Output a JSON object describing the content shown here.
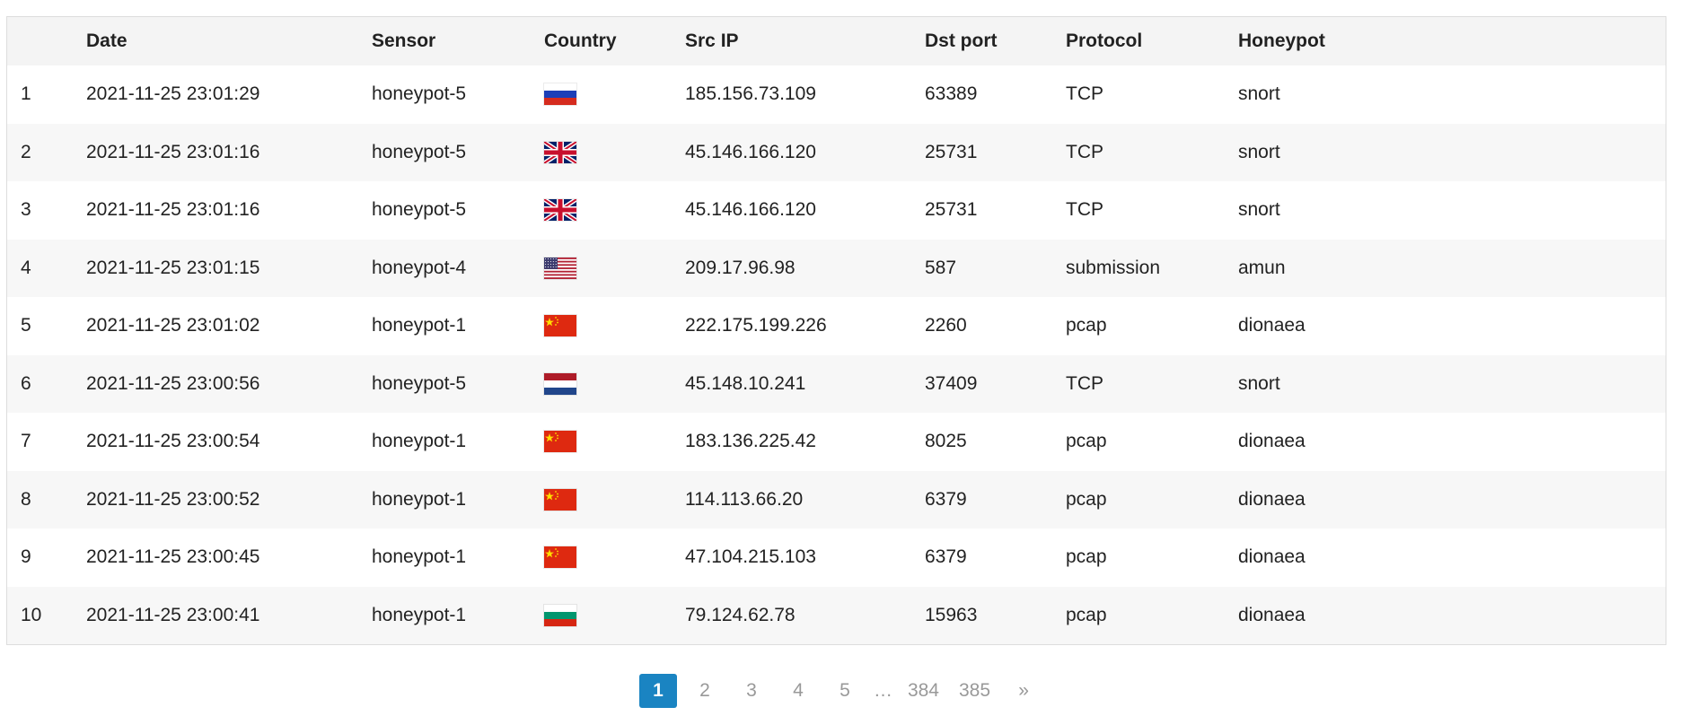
{
  "table": {
    "headers": {
      "num": "",
      "date": "Date",
      "sensor": "Sensor",
      "country": "Country",
      "src_ip": "Src IP",
      "dst_port": "Dst port",
      "protocol": "Protocol",
      "honeypot": "Honeypot"
    },
    "rows": [
      {
        "num": "1",
        "date": "2021-11-25 23:01:29",
        "sensor": "honeypot-5",
        "country_flag": "russia-flag",
        "src_ip": "185.156.73.109",
        "dst_port": "63389",
        "protocol": "TCP",
        "honeypot": "snort"
      },
      {
        "num": "2",
        "date": "2021-11-25 23:01:16",
        "sensor": "honeypot-5",
        "country_flag": "uk-flag",
        "src_ip": "45.146.166.120",
        "dst_port": "25731",
        "protocol": "TCP",
        "honeypot": "snort"
      },
      {
        "num": "3",
        "date": "2021-11-25 23:01:16",
        "sensor": "honeypot-5",
        "country_flag": "uk-flag",
        "src_ip": "45.146.166.120",
        "dst_port": "25731",
        "protocol": "TCP",
        "honeypot": "snort"
      },
      {
        "num": "4",
        "date": "2021-11-25 23:01:15",
        "sensor": "honeypot-4",
        "country_flag": "usa-flag",
        "src_ip": "209.17.96.98",
        "dst_port": "587",
        "protocol": "submission",
        "honeypot": "amun"
      },
      {
        "num": "5",
        "date": "2021-11-25 23:01:02",
        "sensor": "honeypot-1",
        "country_flag": "china-flag",
        "src_ip": "222.175.199.226",
        "dst_port": "2260",
        "protocol": "pcap",
        "honeypot": "dionaea"
      },
      {
        "num": "6",
        "date": "2021-11-25 23:00:56",
        "sensor": "honeypot-5",
        "country_flag": "netherlands-flag",
        "src_ip": "45.148.10.241",
        "dst_port": "37409",
        "protocol": "TCP",
        "honeypot": "snort"
      },
      {
        "num": "7",
        "date": "2021-11-25 23:00:54",
        "sensor": "honeypot-1",
        "country_flag": "china-flag",
        "src_ip": "183.136.225.42",
        "dst_port": "8025",
        "protocol": "pcap",
        "honeypot": "dionaea"
      },
      {
        "num": "8",
        "date": "2021-11-25 23:00:52",
        "sensor": "honeypot-1",
        "country_flag": "china-flag",
        "src_ip": "114.113.66.20",
        "dst_port": "6379",
        "protocol": "pcap",
        "honeypot": "dionaea"
      },
      {
        "num": "9",
        "date": "2021-11-25 23:00:45",
        "sensor": "honeypot-1",
        "country_flag": "china-flag",
        "src_ip": "47.104.215.103",
        "dst_port": "6379",
        "protocol": "pcap",
        "honeypot": "dionaea"
      },
      {
        "num": "10",
        "date": "2021-11-25 23:00:41",
        "sensor": "honeypot-1",
        "country_flag": "bulgaria-flag",
        "src_ip": "79.124.62.78",
        "dst_port": "15963",
        "protocol": "pcap",
        "honeypot": "dionaea"
      }
    ]
  },
  "pagination": {
    "pages": [
      "1",
      "2",
      "3",
      "4",
      "5"
    ],
    "ellipsis": "…",
    "last_pages": [
      "384",
      "385"
    ],
    "next": "»",
    "current": "1"
  },
  "colors": {
    "accent": "#1a84c2",
    "header_bg": "#f4f4f4",
    "row_alt_bg": "#f7f7f7"
  }
}
